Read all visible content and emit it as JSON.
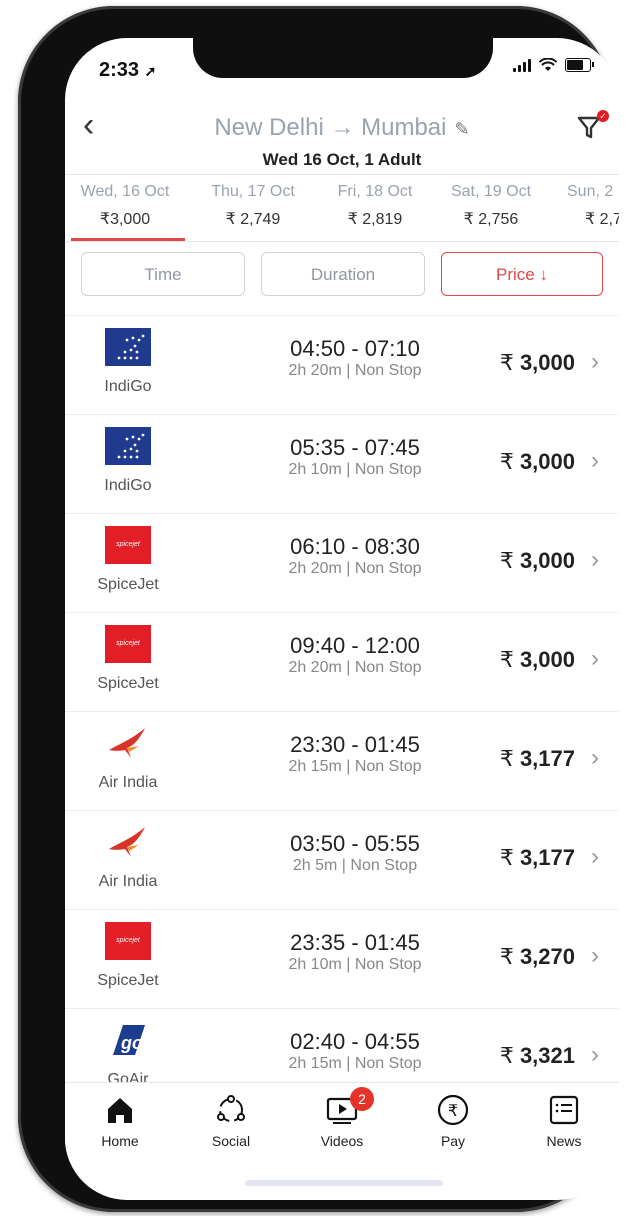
{
  "status": {
    "time": "2:33"
  },
  "header": {
    "route": "New Delhi → Mumbai",
    "subtitle": "Wed 16 Oct, 1 Adult"
  },
  "dates": [
    {
      "date": "Wed, 16 Oct",
      "price": "₹3,000",
      "active": true
    },
    {
      "date": "Thu, 17 Oct",
      "price": "₹ 2,749"
    },
    {
      "date": "Fri, 18 Oct",
      "price": "₹ 2,819"
    },
    {
      "date": "Sat, 19 Oct",
      "price": "₹ 2,756"
    },
    {
      "date": "Sun, 2",
      "price": "₹ 2,7"
    }
  ],
  "sort": {
    "time": "Time",
    "duration": "Duration",
    "price": "Price ↓"
  },
  "flights": [
    {
      "airline": "IndiGo",
      "times": "04:50 - 07:10",
      "meta": "2h 20m | Non Stop",
      "price": "3,000"
    },
    {
      "airline": "IndiGo",
      "times": "05:35 - 07:45",
      "meta": "2h 10m | Non Stop",
      "price": "3,000"
    },
    {
      "airline": "SpiceJet",
      "times": "06:10 - 08:30",
      "meta": "2h 20m | Non Stop",
      "price": "3,000"
    },
    {
      "airline": "SpiceJet",
      "times": "09:40 - 12:00",
      "meta": "2h 20m | Non Stop",
      "price": "3,000"
    },
    {
      "airline": "Air India",
      "times": "23:30 - 01:45",
      "meta": "2h 15m | Non Stop",
      "price": "3,177"
    },
    {
      "airline": "Air India",
      "times": "03:50 - 05:55",
      "meta": "2h 5m | Non Stop",
      "price": "3,177"
    },
    {
      "airline": "SpiceJet",
      "times": "23:35 - 01:45",
      "meta": "2h 10m | Non Stop",
      "price": "3,270"
    },
    {
      "airline": "GoAir",
      "times": "02:40 - 04:55",
      "meta": "2h 15m | Non Stop",
      "price": "3,321"
    }
  ],
  "currency": "₹",
  "spicejet_logo_text": "spicejet",
  "goair_logo_text": "go",
  "tabs": {
    "home": "Home",
    "social": "Social",
    "videos": "Videos",
    "videos_badge": "2",
    "pay": "Pay",
    "news": "News"
  }
}
